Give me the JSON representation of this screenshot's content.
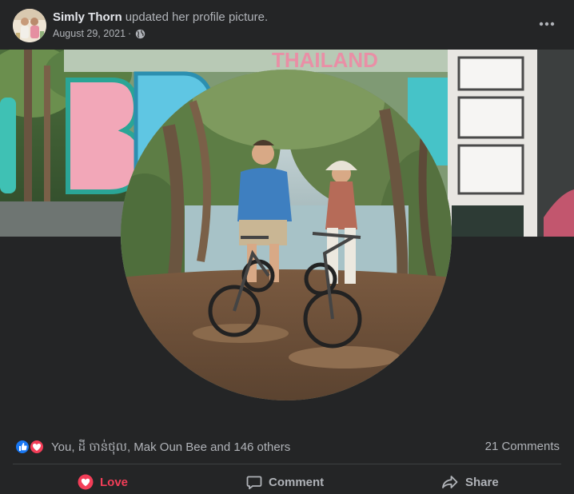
{
  "post": {
    "author": "Simly Thorn",
    "action": "updated her profile picture.",
    "date": "August 29, 2021",
    "separator": "·",
    "privacy_icon": "globe-icon",
    "more_icon": "more-horizontal-icon"
  },
  "cover_sign_text": "THAILAND",
  "reactions": {
    "icons": [
      "like-icon",
      "love-icon"
    ],
    "summary": "You, ដី ចាន់ថុល, Mak Oun Bee and 146 others",
    "comments": "21 Comments"
  },
  "actions": {
    "love_label": "Love",
    "comment_label": "Comment",
    "share_label": "Share"
  },
  "colors": {
    "background": "#242526",
    "primary_text": "#e4e6eb",
    "secondary_text": "#b0b3b8",
    "love_red": "#f33e58",
    "like_blue": "#1877f2",
    "divider": "#3e4042"
  }
}
